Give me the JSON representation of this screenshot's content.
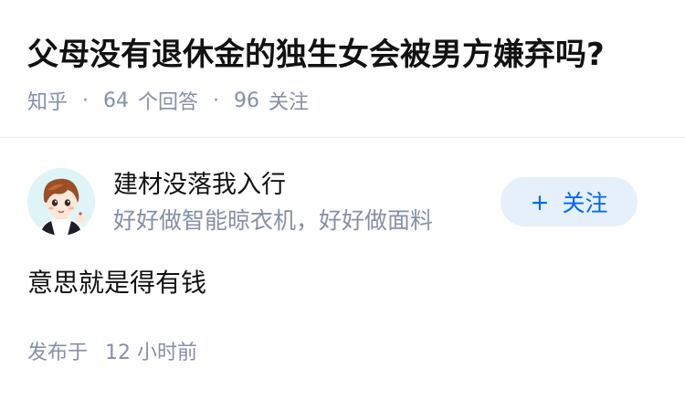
{
  "question": {
    "title": "父母没有退休金的独生女会被男方嫌弃吗?",
    "source": "知乎",
    "separator": "·",
    "answer_count": "64",
    "answer_label": "个回答",
    "follower_count": "96",
    "follower_label": "关注"
  },
  "author": {
    "name": "建材没落我入行",
    "bio": "好好做智能晾衣机，好好做面料",
    "avatar_icon": "cartoon-boy-avatar",
    "follow_plus": "+",
    "follow_label": "关注"
  },
  "answer": {
    "content": "意思就是得有钱",
    "publish_label": "发布于",
    "publish_time": "12 小时前"
  },
  "colors": {
    "title": "#121212",
    "meta": "#8590a6",
    "accent": "#0066ff",
    "follow_bg": "#e6f0fa"
  }
}
